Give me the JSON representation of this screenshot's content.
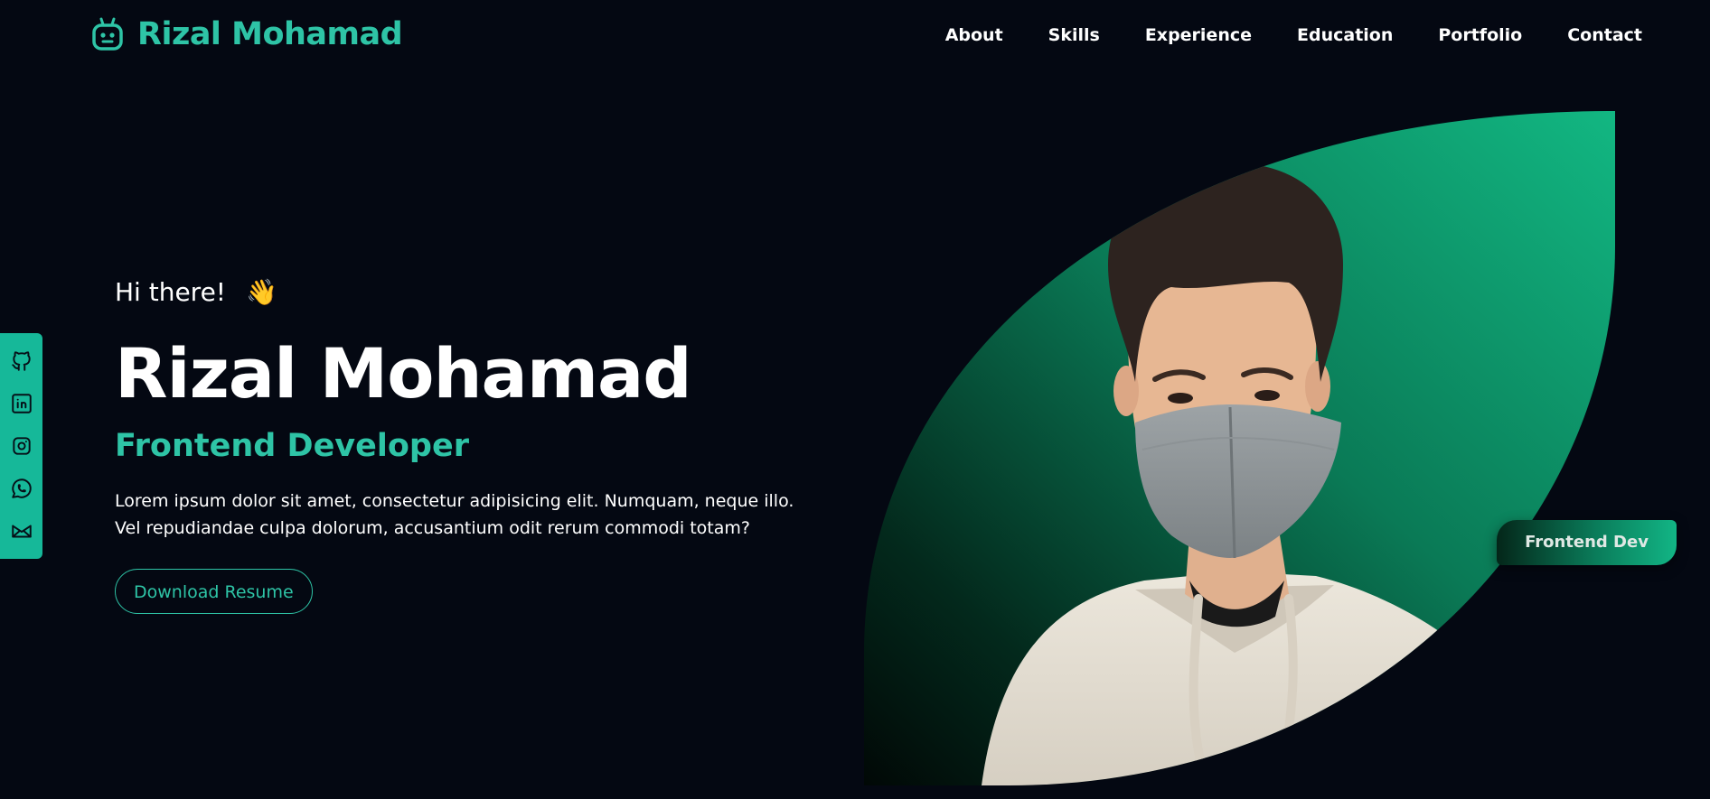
{
  "header": {
    "brand": "Rizal Mohamad",
    "brand_icon": "robot-icon",
    "nav": [
      "About",
      "Skills",
      "Experience",
      "Education",
      "Portfolio",
      "Contact"
    ]
  },
  "social": {
    "icons": [
      "github-icon",
      "linkedin-icon",
      "instagram-icon",
      "whatsapp-icon",
      "mail-icon"
    ]
  },
  "hero": {
    "greeting": "Hi there!",
    "wave": "👋",
    "name": "Rizal Mohamad",
    "role": "Frontend Developer",
    "description": "Lorem ipsum dolor sit amet, consectetur adipisicing elit. Numquam, neque illo. Vel repudiandae culpa dolorum, accusantium odit rerum commodi totam?",
    "button": "Download Resume",
    "badge": "Frontend Dev"
  },
  "colors": {
    "background": "#040812",
    "accent": "#2ec4a6",
    "social_bar": "#16b899",
    "leaf_top": "#12b782",
    "leaf_bottom": "#010806"
  }
}
